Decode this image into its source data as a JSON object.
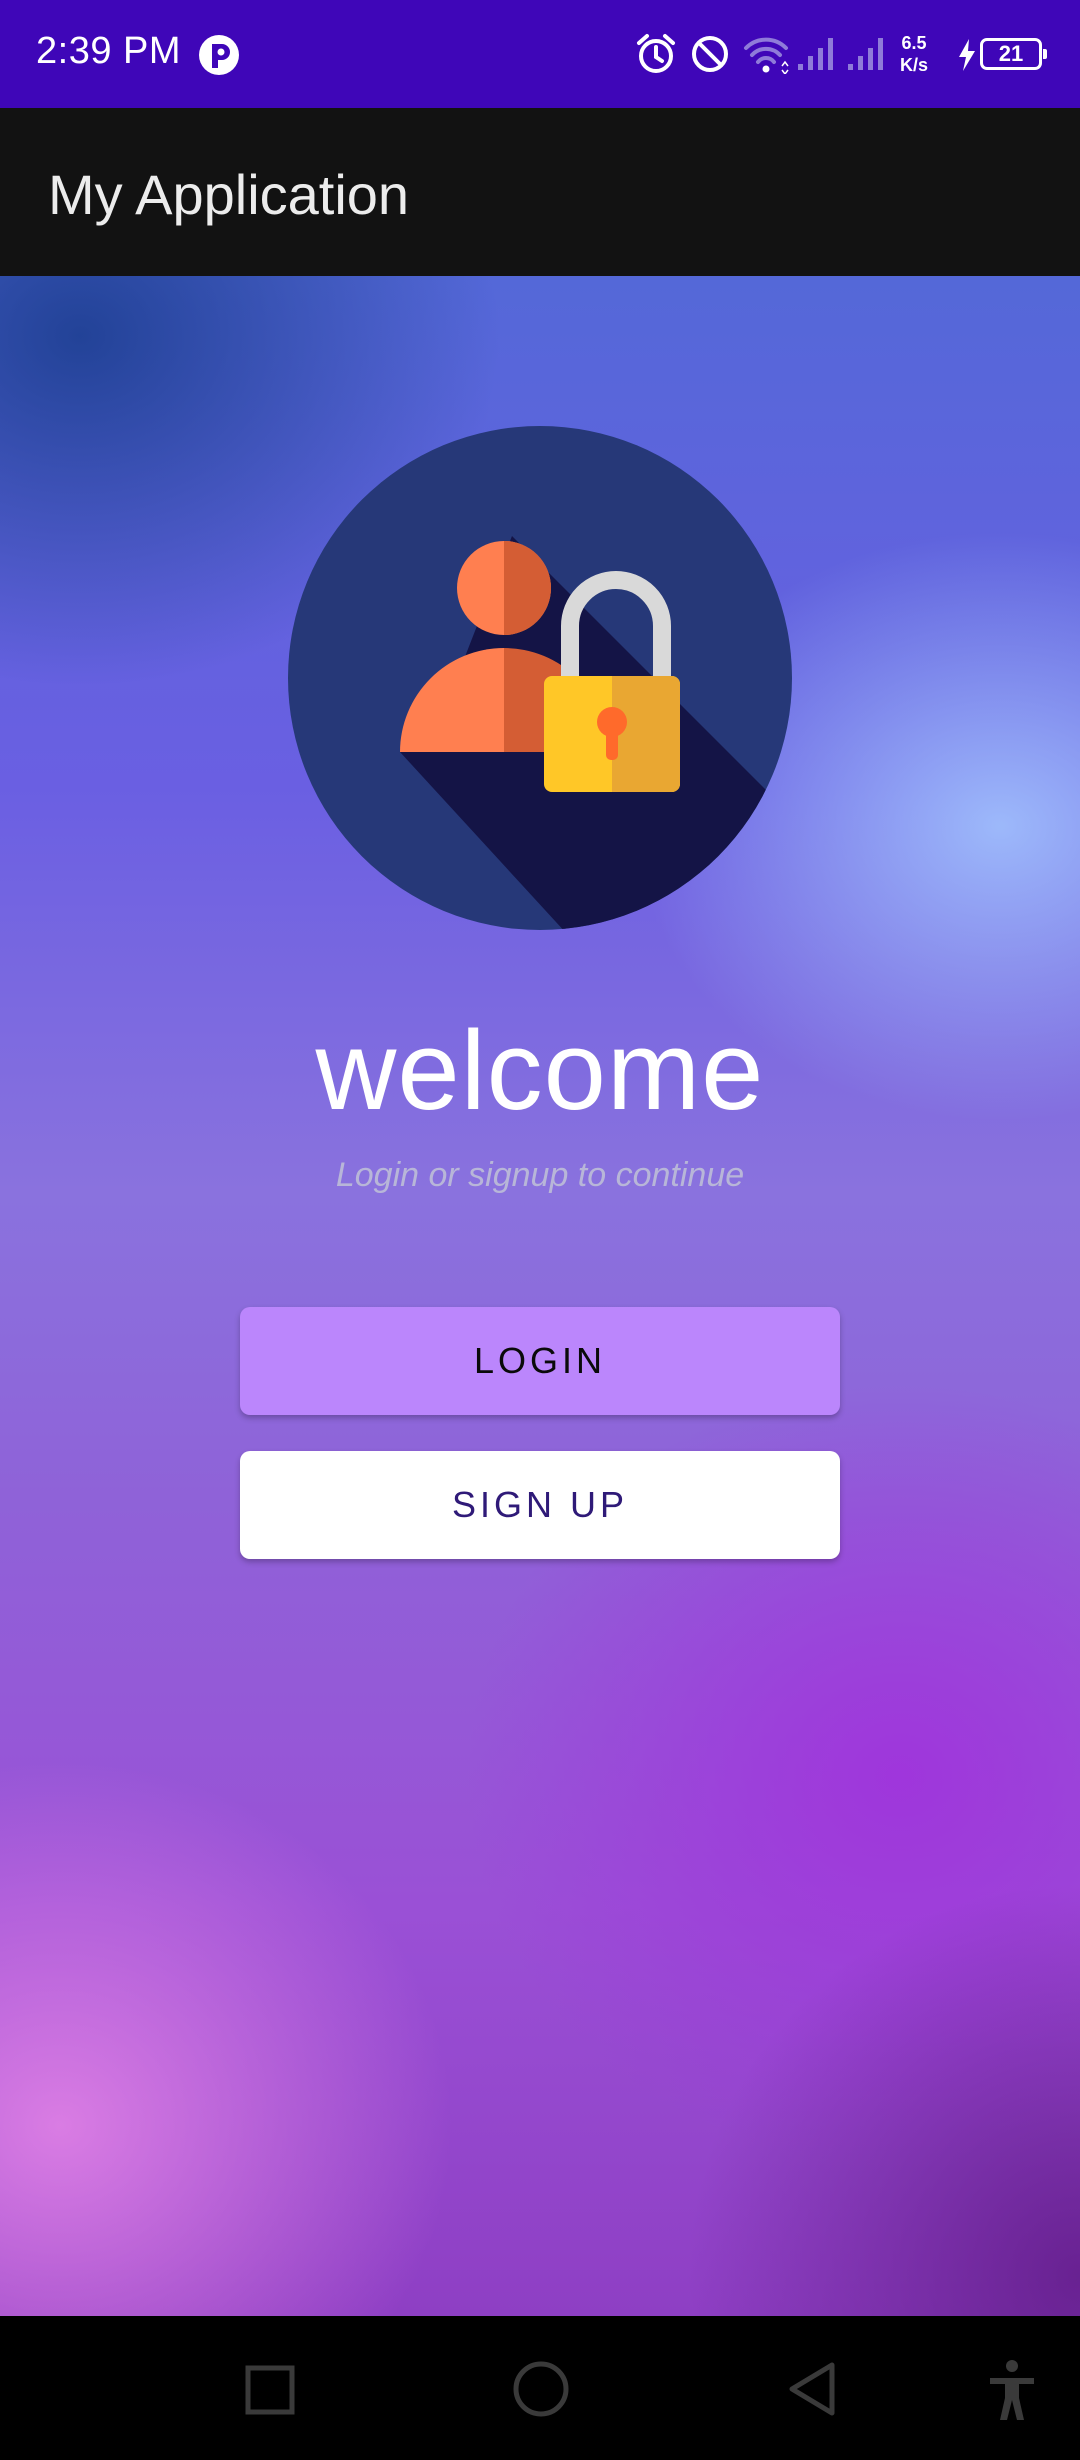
{
  "status_bar": {
    "time": "2:39 PM",
    "net_speed_value": "6.5",
    "net_speed_unit": "K/s",
    "battery_level": "21",
    "icons": [
      "app-notification-icon",
      "alarm-icon",
      "do-not-disturb-icon",
      "wifi-icon",
      "signal-icon",
      "signal-icon",
      "charging-icon",
      "battery-icon"
    ]
  },
  "app_bar": {
    "title": "My Application"
  },
  "main": {
    "logo_icon": "user-lock-icon",
    "welcome": "welcome",
    "subtitle": "Login or signup to continue",
    "login_label": "LOGIN",
    "signup_label": "SIGN UP"
  },
  "nav_bar": {
    "icons": [
      "recents-icon",
      "home-icon",
      "back-icon",
      "accessibility-icon"
    ]
  },
  "colors": {
    "status_bar": "#3f06b8",
    "app_bar": "#121212",
    "login_button": "#bb86fc",
    "signup_button": "#ffffff",
    "signup_text": "#2f1a78"
  }
}
